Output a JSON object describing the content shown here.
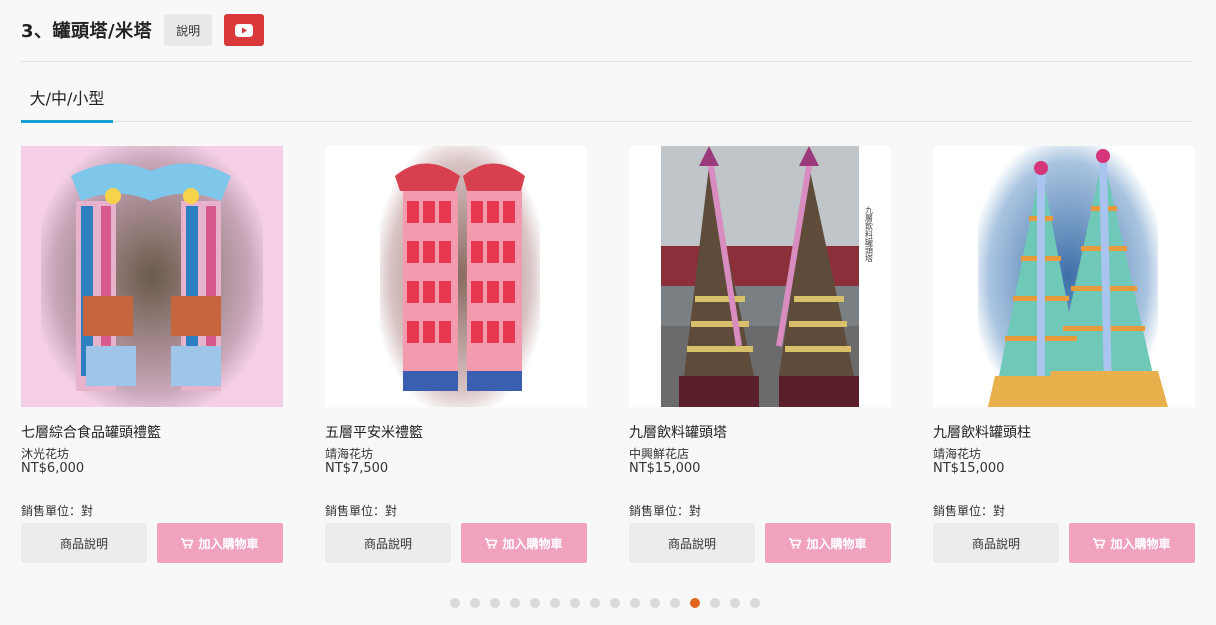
{
  "header": {
    "title": "3、罐頭塔/米塔",
    "explain_label": "說明",
    "video_icon": "youtube-icon"
  },
  "tabs": [
    {
      "label": "大/中/小型",
      "active": true
    }
  ],
  "products": [
    {
      "name": "七層綜合食品罐頭禮籃",
      "shop": "沐光花坊",
      "price": "NT$6,000",
      "unit": "銷售單位：對",
      "info_label": "商品說明",
      "cart_label": "加入購物車"
    },
    {
      "name": "五層平安米禮籃",
      "shop": "靖海花坊",
      "price": "NT$7,500",
      "unit": "銷售單位：對",
      "info_label": "商品說明",
      "cart_label": "加入購物車"
    },
    {
      "name": "九層飲料罐頭塔",
      "shop": "中興鮮花店",
      "price": "NT$15,000",
      "unit": "銷售單位：對",
      "info_label": "商品說明",
      "cart_label": "加入購物車"
    },
    {
      "name": "九層飲料罐頭柱",
      "shop": "靖海花坊",
      "price": "NT$15,000",
      "unit": "銷售單位：對",
      "info_label": "商品說明",
      "cart_label": "加入購物車"
    }
  ],
  "image_caption_3": "九層飲料罐頭塔",
  "pagination": {
    "total": 16,
    "active_index": 12
  },
  "colors": {
    "accent_tab": "#1a9ed6",
    "cart_button": "#f0a2bf",
    "youtube": "#d9393a",
    "active_dot": "#e0641b"
  }
}
